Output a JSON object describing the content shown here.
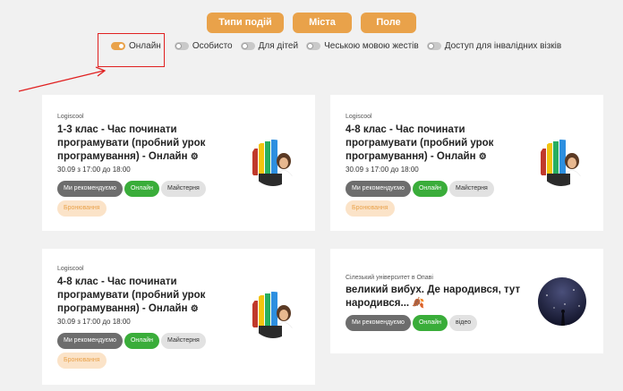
{
  "top_buttons": [
    {
      "label": "Типи подій"
    },
    {
      "label": "Міста"
    },
    {
      "label": "Поле"
    }
  ],
  "filters": [
    {
      "label": "Онлайн",
      "on": true
    },
    {
      "label": "Особисто",
      "on": false
    },
    {
      "label": "Для дітей",
      "on": false
    },
    {
      "label": "Чеською мовою жестів",
      "on": false
    },
    {
      "label": "Доступ для інвалідних візків",
      "on": false
    }
  ],
  "cards": [
    {
      "org": "Logiscool",
      "title": "1-3 клас - Час починати програмувати (пробний урок програмування) - Онлайн",
      "date": "30.09 з 17:00 до 18:00",
      "tags": [
        "Ми рекомендуємо",
        "Онлайн",
        "Майстерня",
        "Бронювання"
      ],
      "thumb_icon": "logiscool-kid-icon"
    },
    {
      "org": "Logiscool",
      "title": "4-8 клас - Час починати програмувати (пробний урок програмування) - Онлайн",
      "date": "30.09 з 17:00 до 18:00",
      "tags": [
        "Ми рекомендуємо",
        "Онлайн",
        "Майстерня",
        "Бронювання"
      ],
      "thumb_icon": "logiscool-kid-icon"
    },
    {
      "org": "Logiscool",
      "title": "4-8 клас - Час починати програмувати (пробний урок програмування) - Онлайн",
      "date": "30.09 з 17:00 до 18:00",
      "tags": [
        "Ми рекомендуємо",
        "Онлайн",
        "Майстерня",
        "Бронювання"
      ],
      "thumb_icon": "logiscool-kid-icon"
    },
    {
      "org": "Сілезький університет в Опаві",
      "title": "великий вибух. Де народився, тут народився...",
      "date": "",
      "tags": [
        "Ми рекомендуємо",
        "Онлайн",
        "відео"
      ],
      "thumb_icon": "night-sky-icon"
    }
  ],
  "colors": {
    "accent": "#e9a24a",
    "online": "#3aad3a",
    "highlight": "#e02020"
  }
}
